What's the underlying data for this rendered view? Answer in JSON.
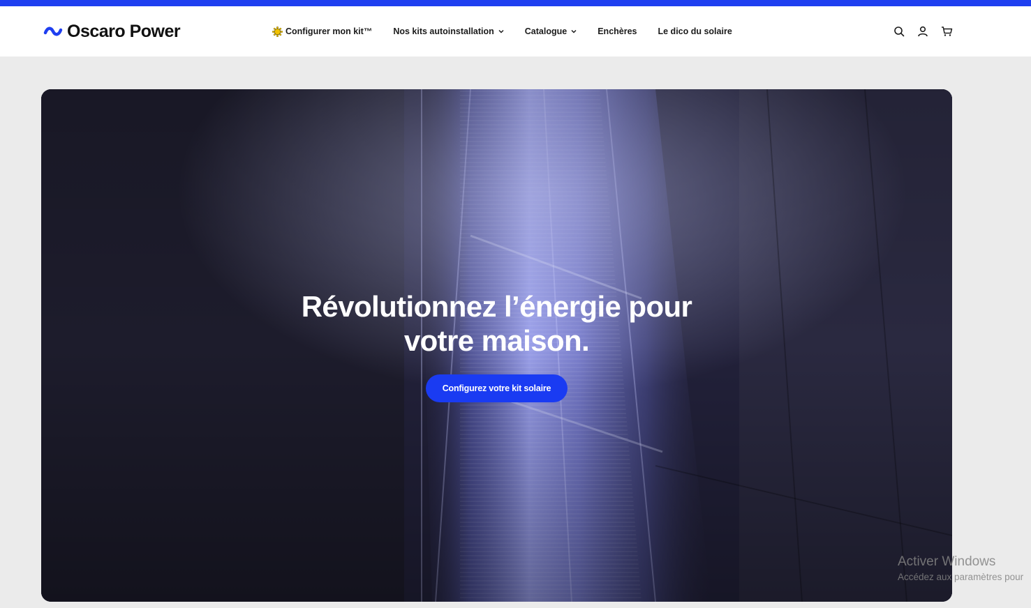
{
  "brand": {
    "name": "Oscaro Power",
    "accent": "#1f3ff0"
  },
  "nav": {
    "items": [
      {
        "label": "Configurer mon kit™",
        "icon": "sun-icon",
        "has_dropdown": false
      },
      {
        "label": "Nos kits autoinstallation",
        "has_dropdown": true
      },
      {
        "label": "Catalogue",
        "has_dropdown": true
      },
      {
        "label": "Enchères",
        "has_dropdown": false
      },
      {
        "label": "Le dico du solaire",
        "has_dropdown": false
      }
    ]
  },
  "header_icons": [
    "search-icon",
    "account-icon",
    "cart-icon"
  ],
  "hero": {
    "title_line1": "Révolutionnez l’énergie pour",
    "title_line2": "votre maison.",
    "cta_label": "Configurez votre kit solaire",
    "cta_color": "#1a3bf2"
  },
  "windows_watermark": {
    "title": "Activer Windows",
    "subtitle": "Accédez aux paramètres pour"
  }
}
